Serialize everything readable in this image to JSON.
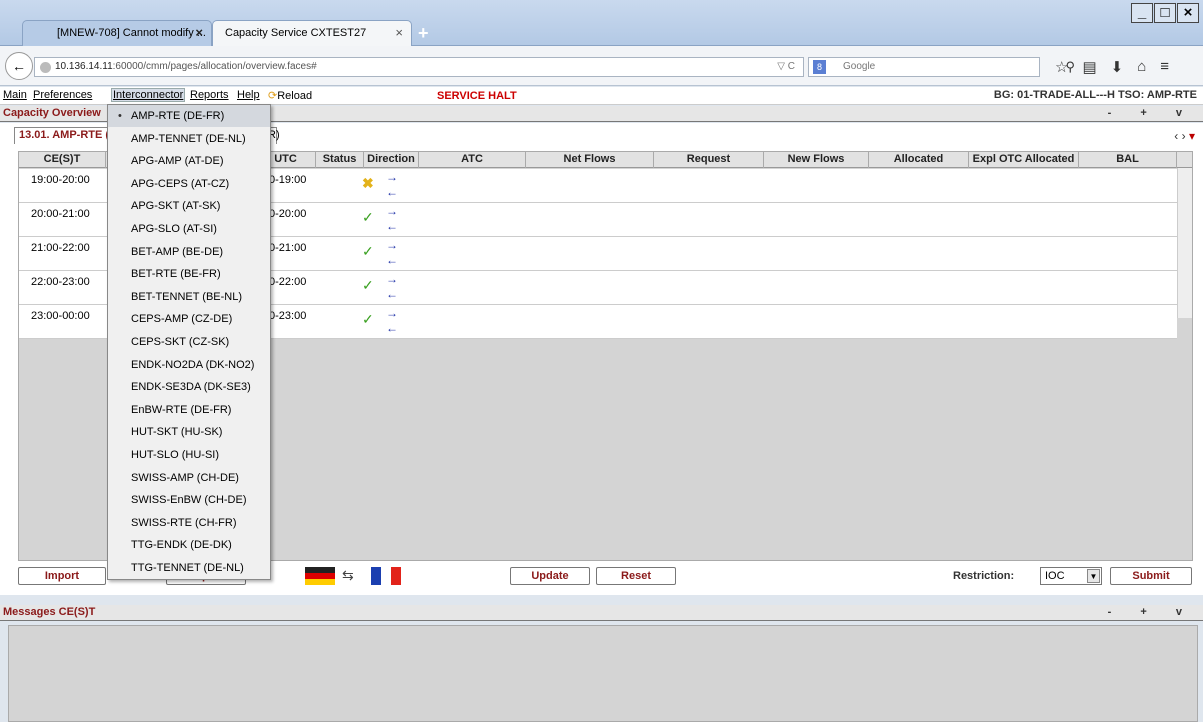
{
  "browser": {
    "tabs": [
      {
        "label": "[MNEW-708] Cannot modify ...",
        "close": "×"
      },
      {
        "label": "Capacity Service CXTEST27",
        "close": "×"
      }
    ],
    "new_tab": "+",
    "window_buttons": [
      "_",
      "□",
      "×"
    ],
    "back": "←",
    "url_host": "10.136.14.11",
    "url_rest": ":60000/cmm/pages/allocation/overview.faces#",
    "url_controls": "▽ C",
    "search_engine": "8",
    "search_placeholder": "Google",
    "search_icon": "⚲",
    "nav_icons": [
      "☆",
      "▤",
      "⬇",
      "⌂",
      "≡"
    ]
  },
  "app_menu": {
    "items": [
      "Main",
      "Preferences",
      "Interconnector",
      "Reports",
      "Help",
      "Reload"
    ],
    "service_status": "SERVICE HALT",
    "bg_info": "BG: 01-TRADE-ALL---H  TSO: AMP-RTE"
  },
  "capacity_panel": {
    "title": "Capacity Overview",
    "controls": "- + v",
    "active_tab": "13.01. AMP-RTE (DE-FR)",
    "second_tab": "R)",
    "tab_nav": "‹ ›",
    "tab_nav_menu": "▾",
    "columns": [
      "CE(S)T",
      "",
      "UTC",
      "Status",
      "Direction",
      "ATC",
      "Net Flows",
      "Request",
      "New Flows",
      "Allocated",
      "Expl OTC Allocated",
      "BAL"
    ],
    "rows": [
      {
        "cest": "19:00-20:00",
        "utc": "0-19:00",
        "status": "✖",
        "status_type": "no",
        "dir_out": "→",
        "dir_in": "←"
      },
      {
        "cest": "20:00-21:00",
        "utc": "0-20:00",
        "status": "✓",
        "status_type": "ok",
        "dir_out": "→",
        "dir_in": "←"
      },
      {
        "cest": "21:00-22:00",
        "utc": "0-21:00",
        "status": "✓",
        "status_type": "ok",
        "dir_out": "→",
        "dir_in": "←"
      },
      {
        "cest": "22:00-23:00",
        "utc": "0-22:00",
        "status": "✓",
        "status_type": "ok",
        "dir_out": "→",
        "dir_in": "←"
      },
      {
        "cest": "23:00-00:00",
        "utc": "0-23:00",
        "status": "✓",
        "status_type": "ok",
        "dir_out": "→",
        "dir_in": "←"
      }
    ],
    "buttons": {
      "import": "Import",
      "export": "Export",
      "update": "Update",
      "reset": "Reset",
      "submit": "Submit"
    },
    "swap": "⇆",
    "restriction_label": "Restriction:",
    "restriction_value": "IOC",
    "restriction_arrow": "▼"
  },
  "messages_panel": {
    "title": "Messages CE(S)T",
    "controls": "- + v"
  },
  "interconnector_menu": {
    "bullet": "•",
    "items": [
      "AMP-RTE (DE-FR)",
      "AMP-TENNET (DE-NL)",
      "APG-AMP (AT-DE)",
      "APG-CEPS (AT-CZ)",
      "APG-SKT (AT-SK)",
      "APG-SLO (AT-SI)",
      "BET-AMP (BE-DE)",
      "BET-RTE (BE-FR)",
      "BET-TENNET (BE-NL)",
      "CEPS-AMP (CZ-DE)",
      "CEPS-SKT (CZ-SK)",
      "ENDK-NO2DA (DK-NO2)",
      "ENDK-SE3DA (DK-SE3)",
      "EnBW-RTE (DE-FR)",
      "HUT-SKT (HU-SK)",
      "HUT-SLO (HU-SI)",
      "SWISS-AMP (CH-DE)",
      "SWISS-EnBW (CH-DE)",
      "SWISS-RTE (CH-FR)",
      "TTG-ENDK (DE-DK)",
      "TTG-TENNET (DE-NL)"
    ]
  }
}
